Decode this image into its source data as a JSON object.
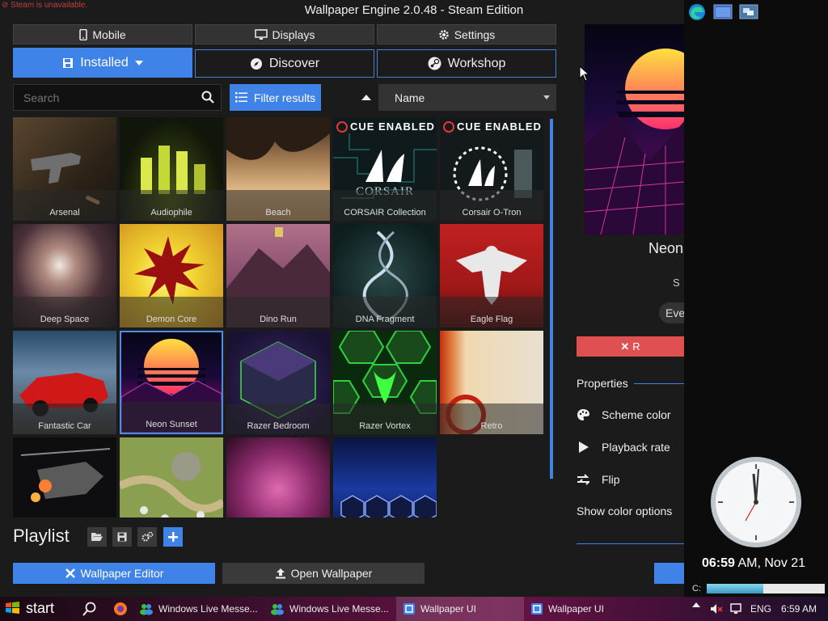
{
  "app": {
    "steam_warning": "Steam is unavailable.",
    "title": "Wallpaper Engine 2.0.48 - Steam Edition"
  },
  "topnav": {
    "mobile": "Mobile",
    "displays": "Displays",
    "settings": "Settings"
  },
  "tabs": {
    "installed": "Installed",
    "discover": "Discover",
    "workshop": "Workshop"
  },
  "toolbar": {
    "search_placeholder": "Search",
    "filter": "Filter results",
    "sort": "Name"
  },
  "wallpapers": [
    {
      "name": "Arsenal"
    },
    {
      "name": "Audiophile"
    },
    {
      "name": "Beach"
    },
    {
      "name": "CORSAIR Collection",
      "badge": "CUE ENABLED",
      "brand": "CORSAIR"
    },
    {
      "name": "Corsair O-Tron",
      "badge": "CUE ENABLED"
    },
    {
      "name": "Deep Space"
    },
    {
      "name": "Demon Core"
    },
    {
      "name": "Dino Run"
    },
    {
      "name": "DNA Fragment"
    },
    {
      "name": "Eagle Flag"
    },
    {
      "name": "Fantastic Car"
    },
    {
      "name": "Neon Sunset"
    },
    {
      "name": "Razer Bedroom"
    },
    {
      "name": "Razer Vortex"
    },
    {
      "name": "Retro"
    },
    {
      "name": ""
    },
    {
      "name": ""
    },
    {
      "name": ""
    },
    {
      "name": ""
    }
  ],
  "playlist": {
    "label": "Playlist"
  },
  "bottom": {
    "editor": "Wallpaper Editor",
    "open": "Open Wallpaper"
  },
  "details": {
    "title": "Neon",
    "subtitle_fragment": "S",
    "rating_fragment": "Eve",
    "remove_fragment": "R",
    "properties": "Properties",
    "scheme_color": "Scheme color",
    "playback_rate": "Playback rate",
    "flip": "Flip",
    "show_color_options": "Show color options"
  },
  "gadget": {
    "time": "06:59",
    "date_suffix": "AM, Nov 21",
    "drive": "C:"
  },
  "taskbar": {
    "start": "start",
    "items": [
      "Windows Live Messe...",
      "Windows Live Messe...",
      "Wallpaper UI",
      "Wallpaper UI"
    ],
    "lang": "ENG",
    "clock": "6:59 AM"
  },
  "colors": {
    "accent": "#3f82e8",
    "danger": "#e05050"
  }
}
